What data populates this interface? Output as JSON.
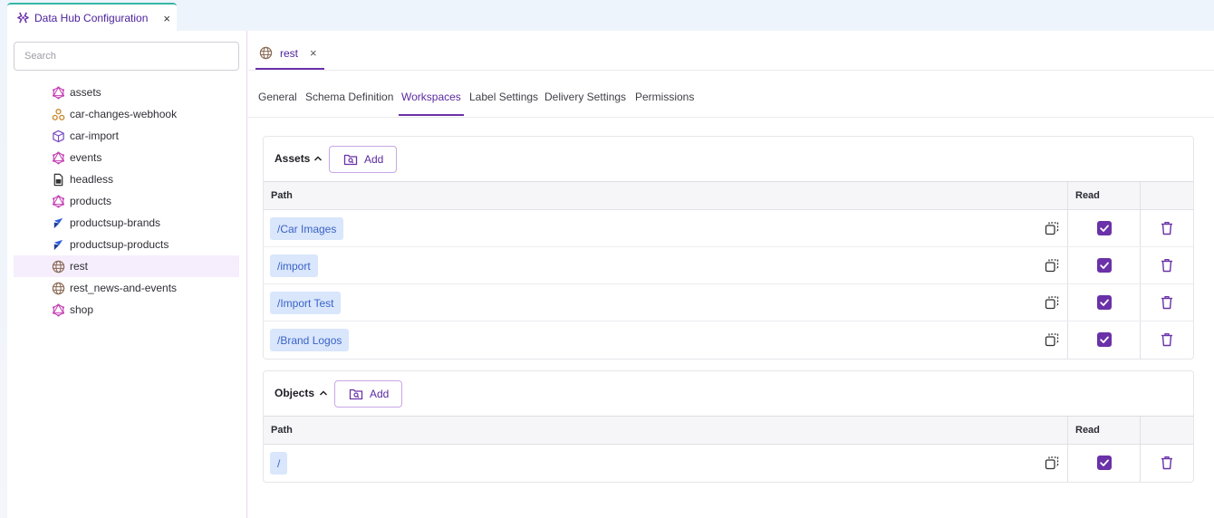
{
  "app_tab": {
    "title": "Data Hub Configuration",
    "close": "×"
  },
  "sidebar": {
    "search_placeholder": "Search",
    "items": [
      {
        "label": "assets",
        "icon": "graphql-icon"
      },
      {
        "label": "car-changes-webhook",
        "icon": "webhook-icon"
      },
      {
        "label": "car-import",
        "icon": "cube-icon"
      },
      {
        "label": "events",
        "icon": "graphql-icon"
      },
      {
        "label": "headless",
        "icon": "file-icon"
      },
      {
        "label": "products",
        "icon": "graphql-icon"
      },
      {
        "label": "productsup-brands",
        "icon": "productsup-icon"
      },
      {
        "label": "productsup-products",
        "icon": "productsup-icon"
      },
      {
        "label": "rest",
        "icon": "globe-icon",
        "active": true
      },
      {
        "label": "rest_news-and-events",
        "icon": "globe-icon"
      },
      {
        "label": "shop",
        "icon": "graphql-icon"
      }
    ]
  },
  "doc_tab": {
    "label": "rest",
    "close": "×"
  },
  "sub_tabs": [
    "General",
    "Schema Definition",
    "Workspaces",
    "Label Settings",
    "Delivery Settings",
    "Permissions"
  ],
  "active_sub_tab": "Workspaces",
  "assets_panel": {
    "title": "Assets",
    "add_label": "Add",
    "columns": {
      "path": "Path",
      "read": "Read"
    },
    "rows": [
      {
        "path": "/Car Images",
        "read": true
      },
      {
        "path": "/import",
        "read": true
      },
      {
        "path": "/Import Test",
        "read": true
      },
      {
        "path": "/Brand Logos",
        "read": true
      }
    ]
  },
  "objects_panel": {
    "title": "Objects",
    "add_label": "Add",
    "columns": {
      "path": "Path",
      "read": "Read"
    },
    "rows": [
      {
        "path": "/",
        "read": true
      }
    ]
  },
  "colors": {
    "accent": "#6a31a8",
    "tag_bg": "#d9e6fb",
    "tag_text": "#3b63c7",
    "graphql": "#c43fb3",
    "teal": "#37b7a6"
  }
}
